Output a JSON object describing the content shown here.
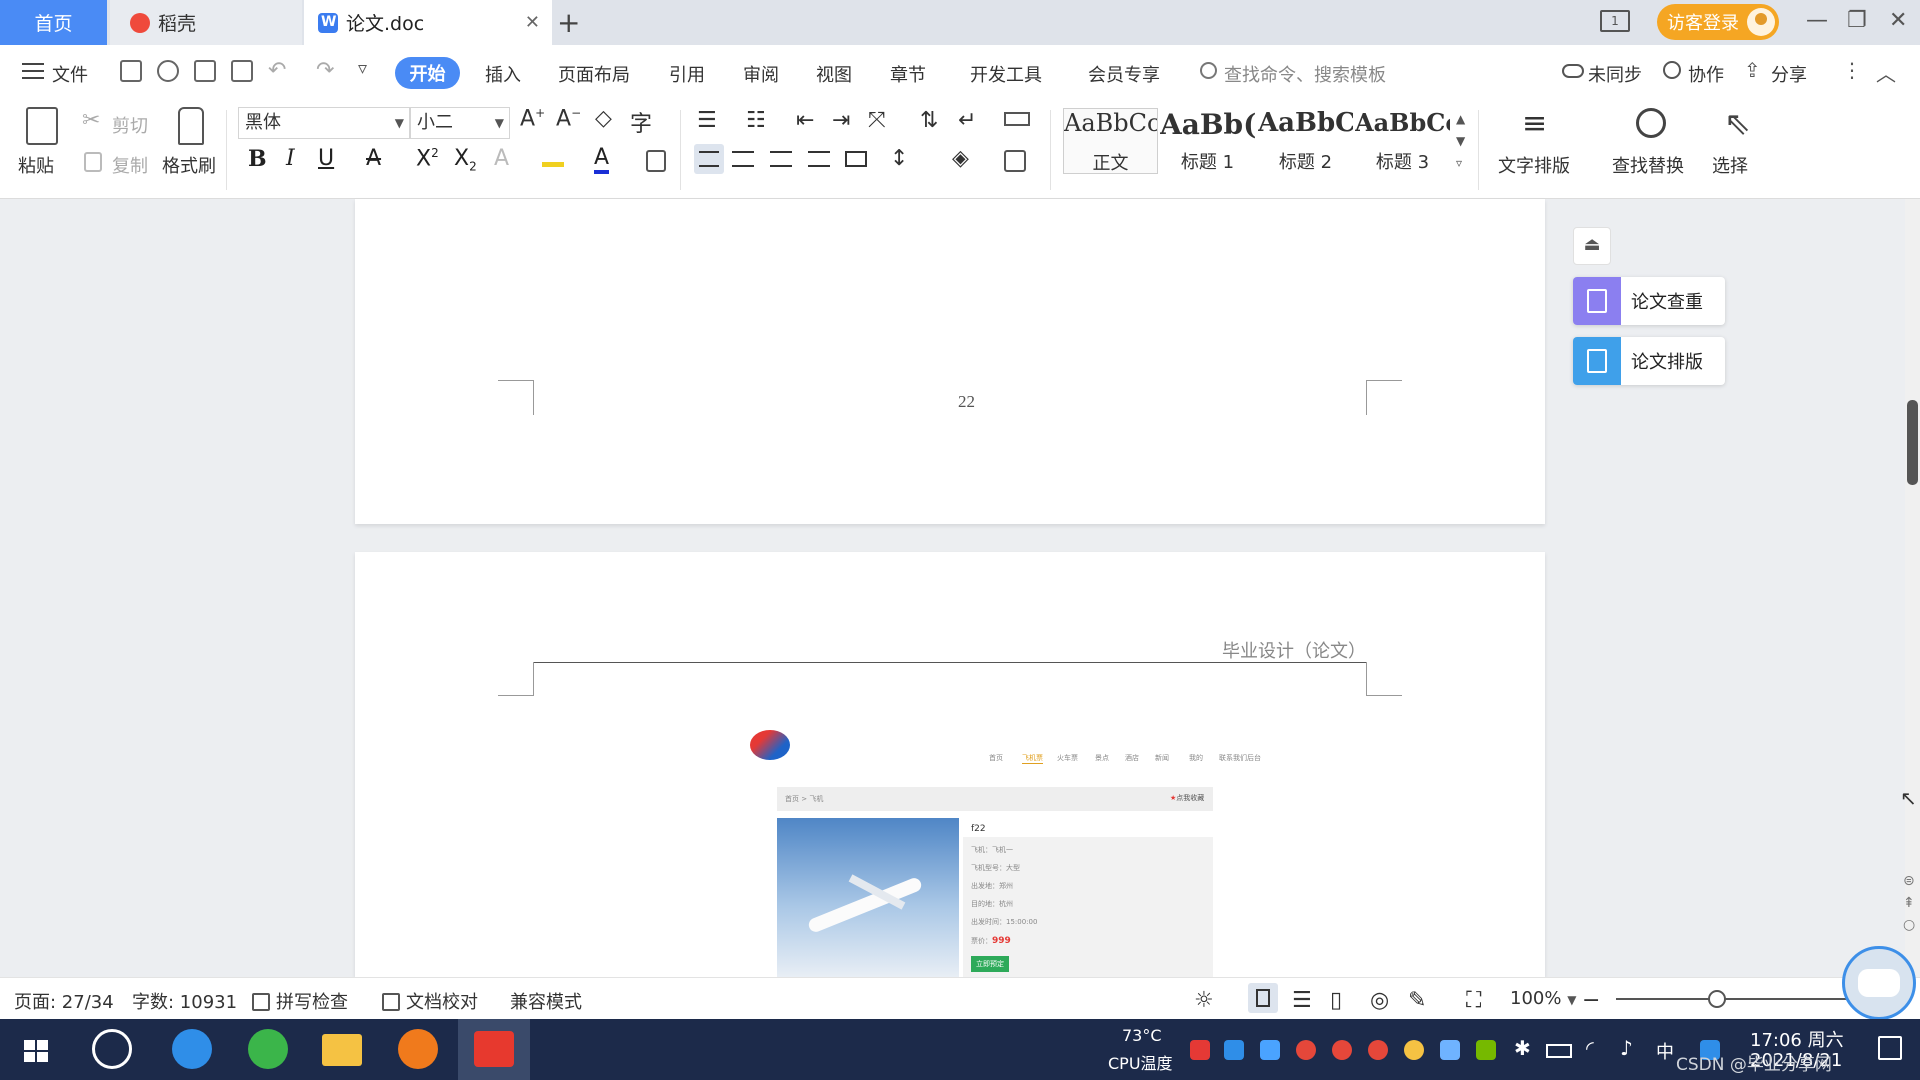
{
  "tabs": {
    "home": "首页",
    "daoke": "稻壳",
    "doc": "论文.doc",
    "close": "✕",
    "add": "+"
  },
  "window": {
    "guest_login": "访客登录",
    "minimize": "—",
    "restore": "❐",
    "close": "✕"
  },
  "menu": {
    "file": "文件",
    "items": [
      "开始",
      "插入",
      "页面布局",
      "引用",
      "审阅",
      "视图",
      "章节",
      "开发工具",
      "会员专享"
    ],
    "search_placeholder": "查找命令、搜索模板",
    "sync": "未同步",
    "collab": "协作",
    "share": "分享"
  },
  "ribbon": {
    "paste": "粘贴",
    "cut": "剪切",
    "copy": "复制",
    "format_painter": "格式刷",
    "font_name": "黑体",
    "font_size": "小二",
    "styles": [
      {
        "sample": "AaBbCcI",
        "label": "正文"
      },
      {
        "sample": "AaBb(",
        "label": "标题 1"
      },
      {
        "sample": "AaBbC",
        "label": "标题 2"
      },
      {
        "sample": "AaBbCcl",
        "label": "标题 3"
      }
    ],
    "text_layout": "文字排版",
    "find_replace": "查找替换",
    "select": "选择"
  },
  "document": {
    "page_number": "22",
    "header": "毕业设计（论文）",
    "shot": {
      "nav": [
        "首页",
        "飞机票",
        "火车票",
        "景点",
        "酒店",
        "新闻",
        "我的",
        "联系我们后台"
      ],
      "breadcrumb": "首页 > 飞机",
      "favorite": "点我收藏",
      "title": "f22",
      "fields": [
        "飞机：飞机一",
        "飞机型号：大型",
        "出发地：郑州",
        "目的地：杭州",
        "出发时间：15:00:00"
      ],
      "price_label": "票价：",
      "price": "999",
      "buy": "立即预定"
    }
  },
  "side_panel": {
    "check": "论文查重",
    "layout": "论文排版"
  },
  "status": {
    "page": "页面: 27/34",
    "words": "字数: 10931",
    "spell": "拼写检查",
    "proof": "文档校对",
    "compat": "兼容模式",
    "zoom": "100%"
  },
  "taskbar": {
    "temp": "73°C",
    "cpu": "CPU温度",
    "ime": "中",
    "time": "17:06 周六",
    "date": "2021/8/21",
    "watermark": "CSDN @毕业分享网"
  },
  "colors": {
    "accent": "#4a8bf5",
    "guest": "#f5a623",
    "taskbar": "#1c2a4a"
  }
}
